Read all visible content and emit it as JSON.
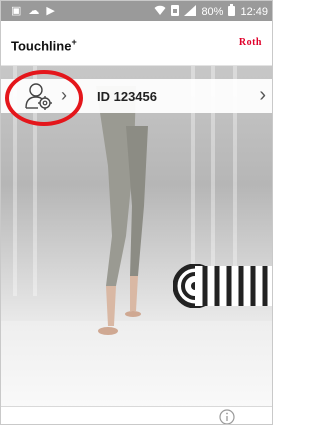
{
  "status_bar": {
    "battery": "80%",
    "time": "12:49",
    "icons": [
      "image-icon",
      "cloud-icon",
      "play-icon",
      "wifi-icon",
      "sim-icon",
      "signal-icon",
      "battery-icon"
    ]
  },
  "header": {
    "title": "Touchline",
    "title_superscript": "+",
    "brand": "Roth"
  },
  "device_row": {
    "id_label": "ID 123456",
    "icons": [
      "user-settings-icon",
      "chevron-right-icon"
    ]
  },
  "footer": {
    "icons": [
      "info-icon"
    ]
  },
  "colors": {
    "brand_red": "#e0002a",
    "highlight_ring": "#e4161b",
    "status_bar": "#9a9a9a"
  }
}
